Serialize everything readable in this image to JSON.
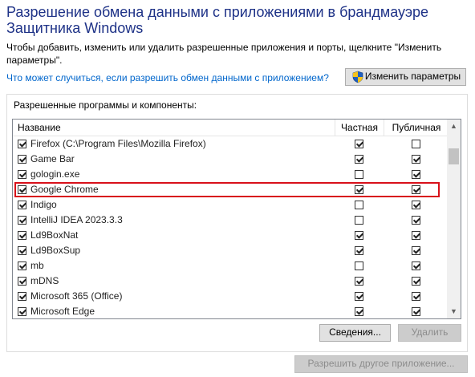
{
  "header": {
    "title": "Разрешение обмена данными с приложениями в брандмауэре Защитника Windows",
    "description": "Чтобы добавить, изменить или удалить разрешенные приложения и порты, щелкните \"Изменить параметры\".",
    "help_link": "Что может случиться, если разрешить обмен данными с приложением?",
    "change_settings_label": "Изменить параметры"
  },
  "group": {
    "label": "Разрешенные программы и компоненты:"
  },
  "list": {
    "columns": {
      "name": "Название",
      "private": "Частная",
      "public": "Публичная"
    },
    "rows": [
      {
        "name": "Firefox (C:\\Program Files\\Mozilla Firefox)",
        "enabled": true,
        "private": true,
        "public": false
      },
      {
        "name": "Game Bar",
        "enabled": true,
        "private": true,
        "public": true
      },
      {
        "name": "gologin.exe",
        "enabled": true,
        "private": false,
        "public": true
      },
      {
        "name": "Google Chrome",
        "enabled": true,
        "private": true,
        "public": true,
        "highlighted": true
      },
      {
        "name": "Indigo",
        "enabled": true,
        "private": false,
        "public": true
      },
      {
        "name": "IntelliJ IDEA 2023.3.3",
        "enabled": true,
        "private": false,
        "public": true
      },
      {
        "name": "Ld9BoxNat",
        "enabled": true,
        "private": true,
        "public": true
      },
      {
        "name": "Ld9BoxSup",
        "enabled": true,
        "private": true,
        "public": true
      },
      {
        "name": "mb",
        "enabled": true,
        "private": false,
        "public": true
      },
      {
        "name": "mDNS",
        "enabled": true,
        "private": true,
        "public": true
      },
      {
        "name": "Microsoft 365 (Office)",
        "enabled": true,
        "private": true,
        "public": true
      },
      {
        "name": "Microsoft Edge",
        "enabled": true,
        "private": true,
        "public": true
      }
    ]
  },
  "buttons": {
    "details": "Сведения...",
    "delete": "Удалить",
    "allow_other": "Разрешить другое приложение..."
  },
  "colors": {
    "title": "#1e3287",
    "link": "#0066cc",
    "highlight": "#d8101a"
  },
  "icons": {
    "change_settings": "uac-shield-icon",
    "scroll_up": "chevron-up-icon",
    "scroll_down": "chevron-down-icon"
  }
}
